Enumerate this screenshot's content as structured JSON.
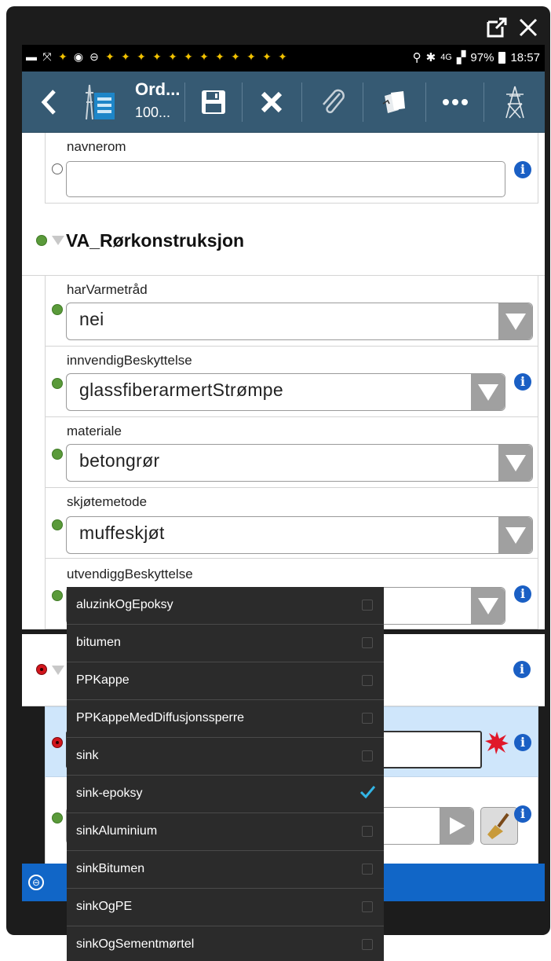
{
  "toolbar": {
    "title": "Ord...",
    "subtitle": "100..."
  },
  "status_bar": {
    "network": "4G",
    "battery": "97%",
    "time": "18:57"
  },
  "fields": {
    "navnerom": {
      "label": "navnerom",
      "value": ""
    },
    "section": {
      "title": "VA_Rørkonstruksjon"
    },
    "harVarmetraad": {
      "label": "harVarmetråd",
      "value": "nei"
    },
    "innvendigBeskyttelse": {
      "label": "innvendigBeskyttelse",
      "value": "glassfiberarmertStrømpe"
    },
    "materiale": {
      "label": "materiale",
      "value": "betongrør"
    },
    "skjoetemetode": {
      "label": "skjøtemetode",
      "value": "muffeskjøt"
    },
    "utvendiggBeskyttelse": {
      "label": "utvendiggBeskyttelse",
      "value": ""
    }
  },
  "dropdown": {
    "options": [
      {
        "label": "aluzinkOgEpoksy",
        "checked": false
      },
      {
        "label": "bitumen",
        "checked": false
      },
      {
        "label": "PPKappe",
        "checked": false
      },
      {
        "label": "PPKappeMedDiffusjonssperre",
        "checked": false
      },
      {
        "label": "sink",
        "checked": false
      },
      {
        "label": "sink-epoksy",
        "checked": true
      },
      {
        "label": "sinkAluminium",
        "checked": false
      },
      {
        "label": "sinkBitumen",
        "checked": false
      },
      {
        "label": "sinkOgPE",
        "checked": false
      },
      {
        "label": "sinkOgSementmørtel",
        "checked": false
      }
    ]
  },
  "colors": {
    "toolbar": "#365a73",
    "accent_blue": "#1166c7",
    "status_green": "#5a9a3a",
    "status_red": "#d2151c",
    "info_blue": "#1a5fc4",
    "highlight_row": "#cfe6fb"
  }
}
